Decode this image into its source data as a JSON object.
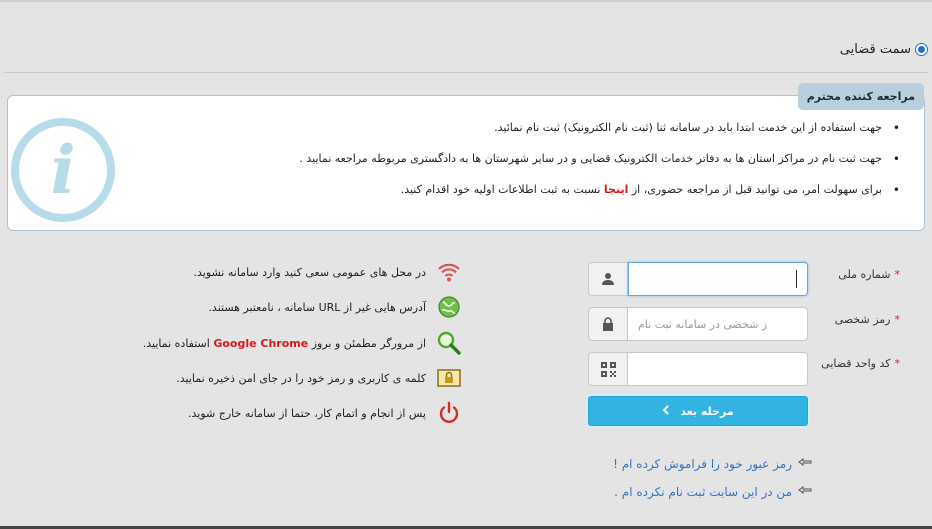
{
  "radio": {
    "label": "سمت قضایی",
    "checked": true
  },
  "info": {
    "title": "مراجعه کننده محترم",
    "items": [
      "جهت استفاده از این خدمت ابتدا باید در سامانه ثنا (ثبت نام الکترونیک) ثبت نام نمائید.",
      "جهت ثبت نام در مراکز استان ها به دفاتر خدمات الکترونیک قضایی و در سایر شهرستان ها به دادگستری مربوطه مراجعه نمایید ."
    ],
    "item3_before": "برای سهولت امر، می توانید قبل از مراجعه حضوری، از",
    "item3_link": "اینجا",
    "item3_after": "نسبت به ثبت اطلاعات اولیه خود اقدام کنید."
  },
  "form": {
    "national_code_label": "شماره ملی",
    "password_label": "رمز شخصی",
    "password_placeholder": "ز شخصی در سامانه ثبت نام",
    "judicial_code_label": "کد واحد قضایی",
    "required_mark": "*",
    "next_label": "مرحله بعد",
    "forgot_link": "رمز عبور خود را فراموش کرده ام !",
    "register_link": "من در این سایت ثبت نام نکرده ام ."
  },
  "tips": {
    "t1": "در محل های عمومی سعی کنید وارد سامانه نشوید.",
    "t2": "آدرس هایی غیر از URL سامانه ، نامعتبر هستند.",
    "t3_before": "از مرورگر مطمئن و بروز",
    "t3_brand": "Google Chrome",
    "t3_after": "استفاده نمایید.",
    "t4": "کلمه ی کاربری و رمز خود را در جای امن ذخیره نمایید.",
    "t5": "پس از انجام و اتمام کار، حتما از سامانه خارج شوید."
  },
  "colors": {
    "accent": "#33b3e2",
    "required": "#d81b1b",
    "link": "#3573c4",
    "info_border": "#a8c4d8"
  },
  "icons": [
    "user-icon",
    "lock-icon",
    "qr-code-icon",
    "chevron-left-icon",
    "hand-pointer-icon",
    "wifi-icon",
    "globe-icon",
    "magnifier-icon",
    "lock-folder-icon",
    "power-icon",
    "info-icon"
  ]
}
